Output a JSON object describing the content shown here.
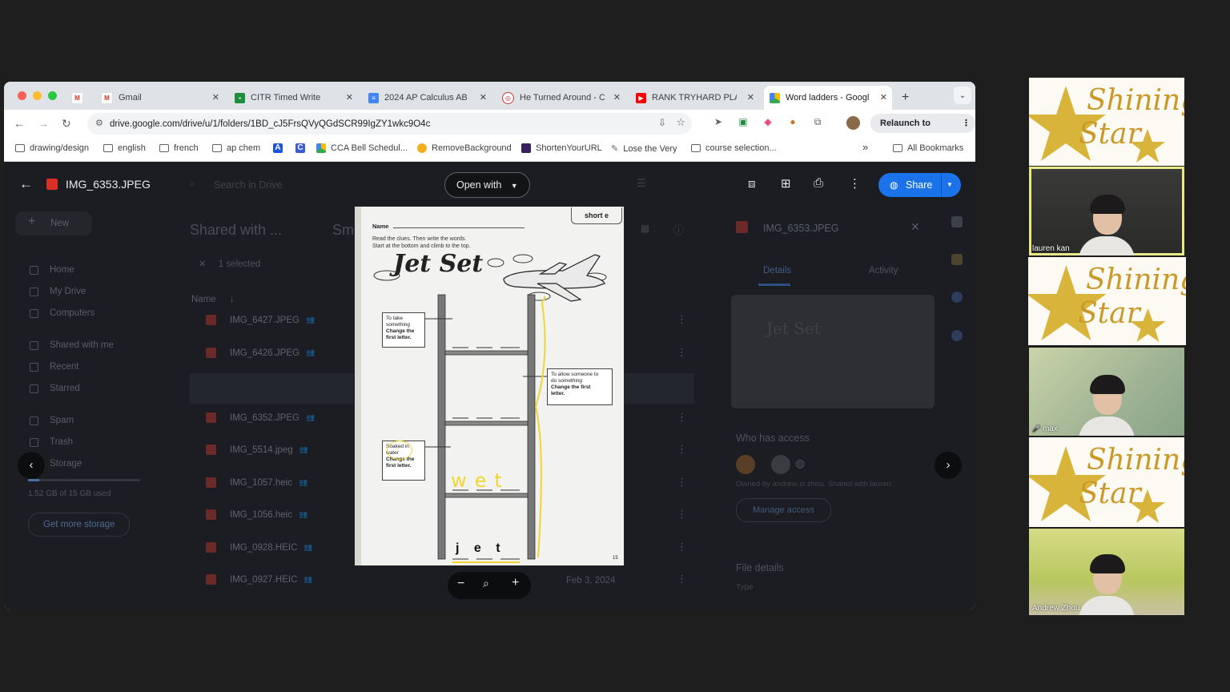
{
  "browser": {
    "tabs": [
      {
        "title": "",
        "icon": "gmail-icon"
      },
      {
        "title": "Gmail",
        "icon": "gmail-icon"
      },
      {
        "title": "CITR Timed Write",
        "icon": "classroom-icon"
      },
      {
        "title": "2024 AP Calculus AB",
        "icon": "docs-icon"
      },
      {
        "title": "He Turned Around - C",
        "icon": "web-icon"
      },
      {
        "title": "RANK TRYHARD PLAY",
        "icon": "youtube-icon"
      },
      {
        "title": "Word ladders - Googl",
        "icon": "drive-icon"
      }
    ],
    "new_tab": "+",
    "url": "drive.google.com/drive/u/1/folders/1BD_cJ5FrsQVyQGdSCR99IgZY1wkc9O4c",
    "relaunch_label": "Relaunch to update",
    "bookmarks": [
      {
        "label": "drawing/design"
      },
      {
        "label": "english"
      },
      {
        "label": "french"
      },
      {
        "label": "ap chem"
      },
      {
        "label": ""
      },
      {
        "label": ""
      },
      {
        "label": "CCA Bell Schedul..."
      },
      {
        "label": "RemoveBackground"
      },
      {
        "label": "ShortenYourURL"
      },
      {
        "label": "Lose the Very"
      },
      {
        "label": "course selection..."
      }
    ],
    "bookmarks_more": "»",
    "all_bookmarks": "All Bookmarks"
  },
  "viewer": {
    "file_name": "IMG_6353.JPEG",
    "search_placeholder": "Search in Drive",
    "open_with": "Open with",
    "share": "Share"
  },
  "drive_bg": {
    "new_label": "New",
    "nav": [
      "Home",
      "My Drive",
      "Computers",
      "Shared with me",
      "Recent",
      "Starred",
      "Spam",
      "Trash",
      "Storage"
    ],
    "storage_text": "1.52 GB of 15 GB used",
    "get_storage": "Get more storage",
    "breadcrumb": "Shared with ...",
    "breadcrumb_tail": "Sm",
    "selected": "1 selected",
    "name_header": "Name",
    "files": [
      "IMG_6427.JPEG",
      "IMG_6426.JPEG",
      "IMG_6353.JPEG",
      "IMG_6352.JPEG",
      "IMG_5514.jpeg",
      "IMG_1057.heic",
      "IMG_1056.heic",
      "IMG_0928.HEIC",
      "IMG_0927.HEIC"
    ],
    "last_date": "Feb 3, 2024"
  },
  "details_panel": {
    "title": "IMG_6353.JPEG",
    "tab_details": "Details",
    "tab_activity": "Activity",
    "who_has_access": "Who has access",
    "owned_by": "Owned by andrew zi zhou. Shared with lauren.",
    "manage_access": "Manage access",
    "file_details": "File details",
    "type_label": "Type"
  },
  "worksheet": {
    "name_label": "Name",
    "tag": "short e",
    "instructions": [
      "Read the clues. Then write the words.",
      "Start at the bottom and climb to the top."
    ],
    "title": "Jet Set",
    "clue1": [
      "To take",
      "something",
      "Change the",
      "first letter."
    ],
    "clue2": [
      "To allow someone to",
      "do something",
      "Change the first",
      "letter."
    ],
    "clue3": [
      "Soaked in",
      "water",
      "Change the",
      "first letter."
    ],
    "handwritten": [
      "w",
      "e",
      "t"
    ],
    "bottom_word": [
      "j",
      "e",
      "t"
    ],
    "page_number": "15"
  },
  "zoom": {
    "minus": "−",
    "plus": "+"
  },
  "participants": [
    {
      "type": "logo",
      "logo_text": [
        "Shining",
        "Star"
      ]
    },
    {
      "type": "camera",
      "name": "lauren kan",
      "active": true
    },
    {
      "type": "logo",
      "logo_text": [
        "Shining",
        "Star"
      ]
    },
    {
      "type": "camera",
      "name": "max",
      "muted": true
    },
    {
      "type": "logo",
      "logo_text": [
        "Shining",
        "Star"
      ]
    },
    {
      "type": "camera",
      "name": "Andrew Zhou"
    }
  ],
  "colors": {
    "accent": "#1a73e8",
    "highlight": "#f5e663",
    "handwriting": "#f5d94a",
    "speaker_border": "#e9e98a"
  }
}
